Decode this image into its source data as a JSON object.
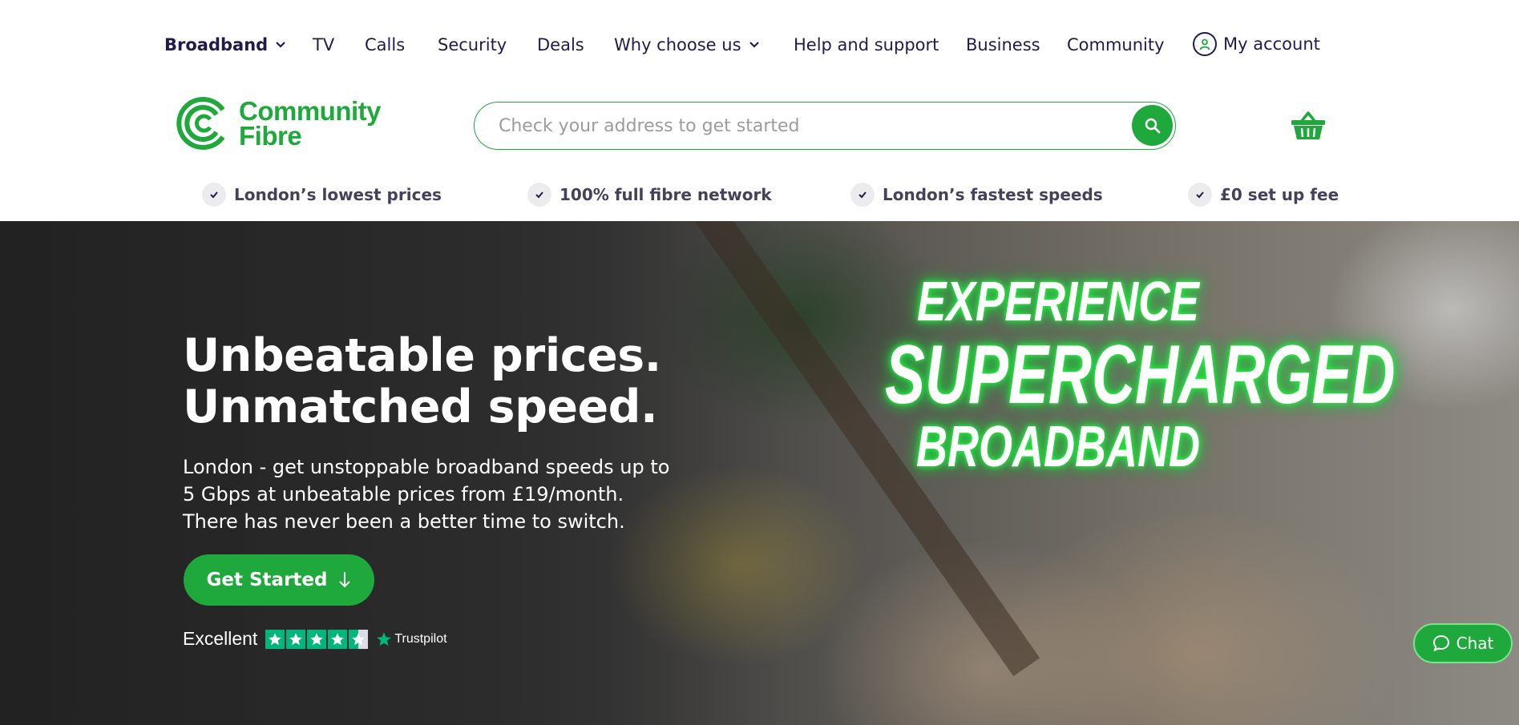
{
  "nav": {
    "items": [
      {
        "label": "Broadband",
        "dropdown": true
      },
      {
        "label": "TV"
      },
      {
        "label": "Calls"
      },
      {
        "label": "Security"
      },
      {
        "label": "Deals"
      },
      {
        "label": "Why choose us",
        "dropdown": true
      },
      {
        "label": "Help and support"
      },
      {
        "label": "Business"
      },
      {
        "label": "Community"
      }
    ],
    "account_label": "My account"
  },
  "logo": {
    "line1": "Community",
    "line2": "Fibre",
    "color": "#1fa83b"
  },
  "search": {
    "placeholder": "Check your address to get started"
  },
  "usps": [
    "London’s lowest prices",
    "100% full fibre network",
    "London’s fastest speeds",
    "£0 set up fee"
  ],
  "hero": {
    "title_line1": "Unbeatable prices.",
    "title_line2": "Unmatched speed.",
    "subtitle": "London - get unstoppable broadband speeds up to 5 Gbps at unbeatable prices from £19/month. There has never been a better time to switch.",
    "cta_label": "Get Started",
    "headline_line1": "EXPERIENCE",
    "headline_line2": "SUPERCHARGED",
    "headline_line3": "BROADBAND"
  },
  "trustpilot": {
    "rating_text": "Excellent",
    "brand": "Trustpilot",
    "stars": 4.5,
    "color": "#00b67a"
  },
  "chat": {
    "label": "Chat"
  },
  "colors": {
    "brand_green": "#1fa83b",
    "nav_text": "#231a4a"
  }
}
